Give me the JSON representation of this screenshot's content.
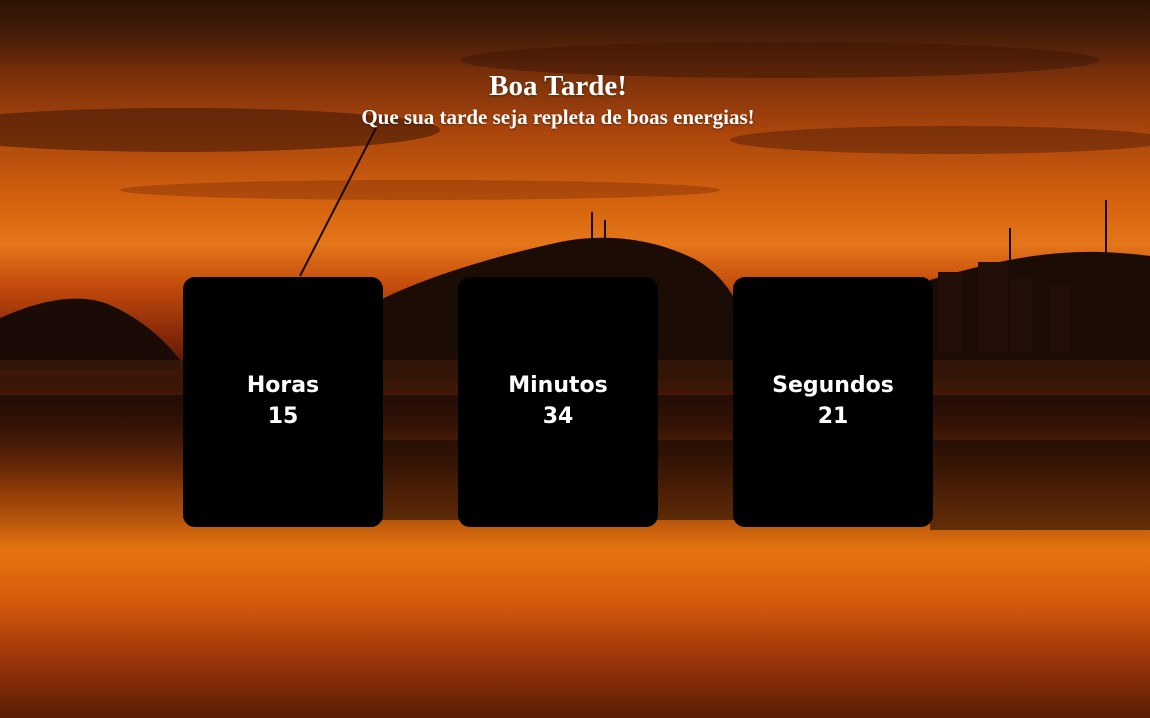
{
  "header": {
    "greeting": "Boa Tarde!",
    "message": "Que sua tarde seja repleta de boas energias!"
  },
  "clock": {
    "hours": {
      "label": "Horas",
      "value": "15"
    },
    "minutes": {
      "label": "Minutos",
      "value": "34"
    },
    "seconds": {
      "label": "Segundos",
      "value": "21"
    }
  },
  "background": {
    "description_icon": "sunset-beach-image",
    "colors": {
      "sky": "#e5761a",
      "dark": "#1a0a04",
      "card": "#000000",
      "text": "#ffffff"
    }
  }
}
